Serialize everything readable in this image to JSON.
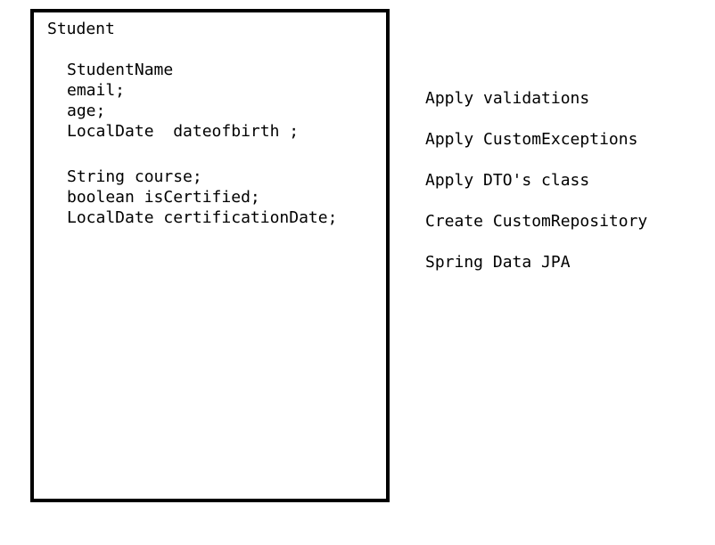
{
  "class_box": {
    "title": "Student",
    "group1": [
      "StudentName",
      "email;",
      "age;",
      "LocalDate  dateofbirth ;"
    ],
    "group2": [
      "String course;",
      "boolean isCertified;",
      "LocalDate certificationDate;"
    ]
  },
  "notes": [
    "Apply validations",
    "Apply CustomExceptions",
    "Apply DTO's class",
    "Create CustomRepository",
    "Spring Data JPA"
  ],
  "colors": {
    "border": "#000000",
    "text": "#000000",
    "background": "#ffffff"
  }
}
